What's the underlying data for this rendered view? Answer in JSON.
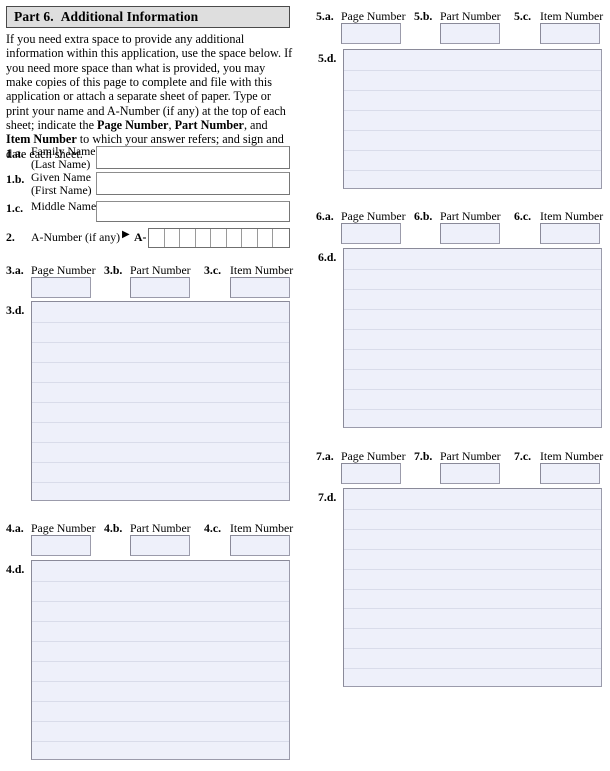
{
  "part_header": {
    "number": "Part 6.",
    "title": "Additional Information"
  },
  "intro": {
    "segments": [
      {
        "text": "If you need extra space to provide any additional information within this application, use the space below.  If you need more space than what is provided, you may make copies of this page to complete and file with this application or attach a separate sheet of paper.  Type or print your name and A-Number (if any) at the top of each sheet; indicate the ",
        "bold": false
      },
      {
        "text": "Page Number",
        "bold": true
      },
      {
        "text": ", ",
        "bold": false
      },
      {
        "text": "Part Number",
        "bold": true
      },
      {
        "text": ", and ",
        "bold": false
      },
      {
        "text": "Item Number",
        "bold": true
      },
      {
        "text": " to which your answer refers; and sign and date each sheet.",
        "bold": false
      }
    ]
  },
  "name_fields": [
    {
      "index": "1.a.",
      "label_line1": "Family Name",
      "label_line2": "(Last Name)",
      "value": ""
    },
    {
      "index": "1.b.",
      "label_line1": "Given Name",
      "label_line2": "(First Name)",
      "value": ""
    },
    {
      "index": "1.c.",
      "label_line1": "Middle Name",
      "label_line2": "",
      "value": ""
    }
  ],
  "anumber": {
    "index": "2.",
    "label": "A-Number (if any)",
    "arrow": "▶",
    "prefix": "A-",
    "cell_count": 9,
    "value": ""
  },
  "ppi_labels": {
    "page": "Page Number",
    "part": "Part Number",
    "item": "Item Number"
  },
  "blocks": [
    {
      "id": "3",
      "column": "left",
      "page_index": "3.a.",
      "part_index": "3.b.",
      "item_index": "3.c.",
      "page_value": "",
      "part_value": "",
      "item_value": "",
      "text_index": "3.d.",
      "text_value": "",
      "rule_count": 10
    },
    {
      "id": "4",
      "column": "left",
      "page_index": "4.a.",
      "part_index": "4.b.",
      "item_index": "4.c.",
      "page_value": "",
      "part_value": "",
      "item_value": "",
      "text_index": "4.d.",
      "text_value": "",
      "rule_count": 10
    },
    {
      "id": "5",
      "column": "right",
      "page_index": "5.a.",
      "part_index": "5.b.",
      "item_index": "5.c.",
      "page_value": "",
      "part_value": "",
      "item_value": "",
      "text_index": "5.d.",
      "text_value": "",
      "rule_count": 7
    },
    {
      "id": "6",
      "column": "right",
      "page_index": "6.a.",
      "part_index": "6.b.",
      "item_index": "6.c.",
      "page_value": "",
      "part_value": "",
      "item_value": "",
      "text_index": "6.d.",
      "text_value": "",
      "rule_count": 9
    },
    {
      "id": "7",
      "column": "right",
      "page_index": "7.a.",
      "part_index": "7.b.",
      "item_index": "7.c.",
      "page_value": "",
      "part_value": "",
      "item_value": "",
      "text_index": "7.d.",
      "text_value": "",
      "rule_count": 10
    }
  ],
  "colors": {
    "field_fill": "#eef0fa",
    "field_border": "#8a8a99",
    "header_fill": "#dedede",
    "header_border": "#4a4a4a",
    "rule_line": "#d9dcea"
  }
}
